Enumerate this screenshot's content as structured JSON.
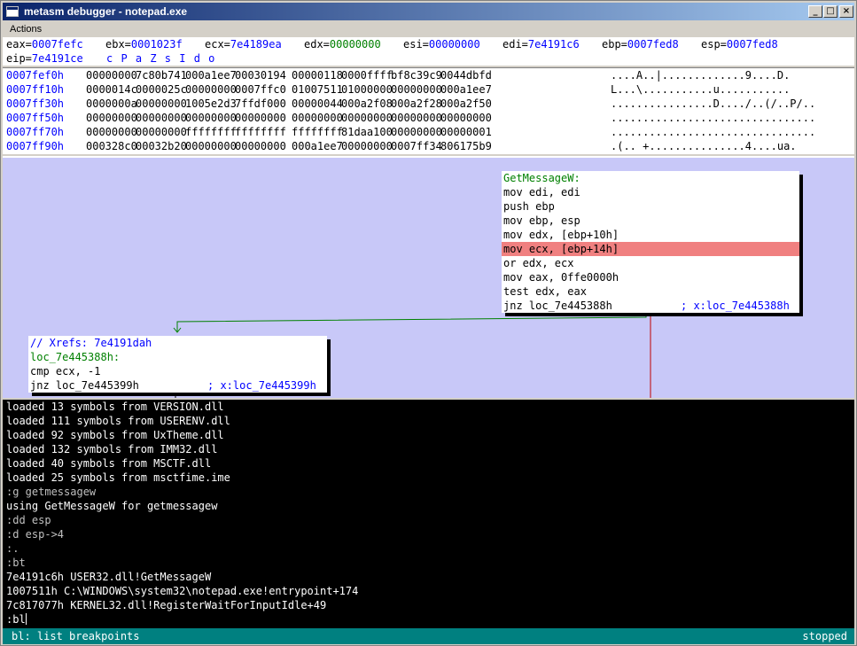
{
  "window": {
    "title": "metasm debugger - notepad.exe",
    "min_label": "_",
    "max_label": "□",
    "close_label": "×"
  },
  "menu": {
    "actions": "Actions"
  },
  "registers": {
    "eax": {
      "label": "eax=",
      "value": "0007fefc"
    },
    "ebx": {
      "label": "ebx=",
      "value": "0001023f"
    },
    "ecx": {
      "label": "ecx=",
      "value": "7e4189ea"
    },
    "edx": {
      "label": "edx=",
      "value": "00000000"
    },
    "esi": {
      "label": "esi=",
      "value": "00000000"
    },
    "edi": {
      "label": "edi=",
      "value": "7e4191c6"
    },
    "ebp": {
      "label": "ebp=",
      "value": "0007fed8"
    },
    "esp": {
      "label": "esp=",
      "value": "0007fed8"
    },
    "eip": {
      "label": "eip=",
      "value": "7e4191ce"
    },
    "flags": "c P a Z s I d o"
  },
  "hexdump": [
    {
      "addr": "0007fef0h",
      "words": [
        "00000000",
        "7c80b741",
        "000a1ee7",
        "00030194",
        "00000118",
        "0000ffff",
        "bf8c39c9",
        "0044dbfd"
      ],
      "ascii": "....A..|.............9....D."
    },
    {
      "addr": "0007ff10h",
      "words": [
        "0000014c",
        "0000025c",
        "00000000",
        "0007ffc0",
        "01007511",
        "01000000",
        "00000000",
        "000a1ee7"
      ],
      "ascii": "L...\\...........u..........."
    },
    {
      "addr": "0007ff30h",
      "words": [
        "0000000a",
        "00000000",
        "1005e2d3",
        "7ffdf000",
        "00000044",
        "000a2f08",
        "000a2f28",
        "000a2f50"
      ],
      "ascii": "................D..../..(/..P/.."
    },
    {
      "addr": "0007ff50h",
      "words": [
        "00000000",
        "00000000",
        "00000000",
        "00000000",
        "00000000",
        "00000000",
        "00000000",
        "00000000"
      ],
      "ascii": "................................"
    },
    {
      "addr": "0007ff70h",
      "words": [
        "00000000",
        "00000000",
        "ffffffff",
        "ffffffff",
        "ffffffff",
        "81daa100",
        "00000000",
        "00000001"
      ],
      "ascii": "................................"
    },
    {
      "addr": "0007ff90h",
      "words": [
        "000328c0",
        "00032b20",
        "00000000",
        "00000000",
        "000a1ee7",
        "00000000",
        "0007ff34",
        "806175b9"
      ],
      "ascii": ".(.. +...............4....ua."
    }
  ],
  "graph": {
    "block1": {
      "label": "GetMessageW:",
      "lines": [
        "mov edi, edi",
        "push ebp",
        "mov ebp, esp",
        "mov edx, [ebp+10h]",
        "mov ecx, [ebp+14h]",
        "or edx, ecx",
        "mov eax, 0ffe0000h",
        "test edx, eax"
      ],
      "last_instr": "jnz loc_7e445388h",
      "last_comment_prefix": "; x:",
      "last_comment_ref": "loc_7e445388h"
    },
    "block2": {
      "xrefs": "// Xrefs: 7e4191dah",
      "label": "loc_7e445388h:",
      "lines": [
        "cmp ecx, -1"
      ],
      "last_instr": "jnz loc_7e445399h",
      "last_comment_prefix": "; x:",
      "last_comment_ref": "loc_7e445399h"
    }
  },
  "console": [
    "loaded 13 symbols from VERSION.dll",
    "loaded 111 symbols from USERENV.dll",
    "loaded 92 symbols from UxTheme.dll",
    "loaded 132 symbols from IMM32.dll",
    "loaded 40 symbols from MSCTF.dll",
    "loaded 25 symbols from msctfime.ime",
    ":g getmessagew",
    "using GetMessageW for getmessagew",
    ":dd esp",
    ":d esp->4",
    ":.",
    ":bt",
    "7e4191c6h USER32.dll!GetMessageW",
    "1007511h C:\\WINDOWS\\system32\\notepad.exe!entrypoint+174",
    "7c817077h KERNEL32.dll!RegisterWaitForInputIdle+49"
  ],
  "console_input": ":bl",
  "status": {
    "left": "bl: list breakpoints",
    "right": "stopped"
  }
}
